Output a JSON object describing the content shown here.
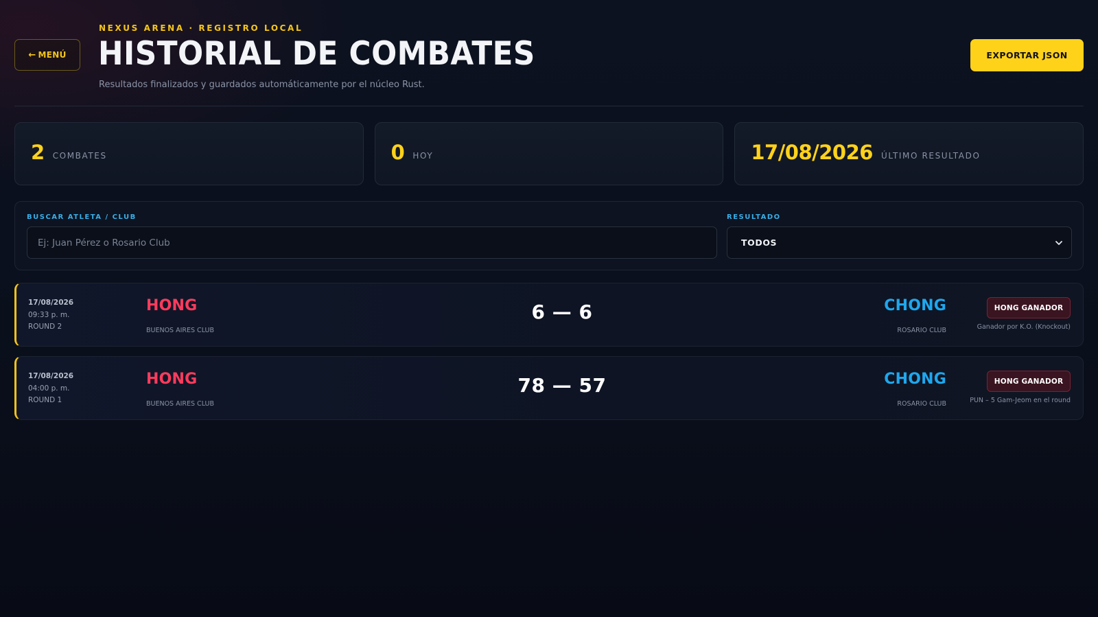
{
  "header": {
    "back_label": "MENÚ",
    "kicker": "NEXUS ARENA · REGISTRO LOCAL",
    "title": "HISTORIAL DE COMBATES",
    "subtitle": "Resultados finalizados y guardados automáticamente por el núcleo Rust.",
    "export_label": "EXPORTAR JSON"
  },
  "stats": [
    {
      "value": "2",
      "label": "COMBATES"
    },
    {
      "value": "0",
      "label": "HOY"
    },
    {
      "value": "17/08/2026",
      "label": "ÚLTIMO RESULTADO"
    }
  ],
  "filters": {
    "search_label": "BUSCAR ATLETA / CLUB",
    "search_placeholder": "Ej: Juan Pérez o Rosario Club",
    "search_value": "",
    "result_label": "RESULTADO",
    "result_value": "TODOS"
  },
  "fights": [
    {
      "date": "17/08/2026",
      "time": "09:33 p. m.",
      "round": "ROUND 2",
      "left_name": "HONG",
      "left_club": "BUENOS AIRES CLUB",
      "score": "6 — 6",
      "right_name": "CHONG",
      "right_club": "ROSARIO CLUB",
      "badge": "HONG GANADOR",
      "note": "Ganador por K.O. (Knockout)"
    },
    {
      "date": "17/08/2026",
      "time": "04:00 p. m.",
      "round": "ROUND 1",
      "left_name": "HONG",
      "left_club": "BUENOS AIRES CLUB",
      "score": "78 — 57",
      "right_name": "CHONG",
      "right_club": "ROSARIO CLUB",
      "badge": "HONG GANADOR",
      "note": "PUN – 5 Gam-Jeom en el round"
    }
  ],
  "colors": {
    "accent": "#ffd21a",
    "red_corner": "#ff3b5c",
    "blue_corner": "#1ea7ee",
    "label_blue": "#38aee8",
    "background": "#0a0f1c"
  },
  "icons": {
    "back": "arrow-left-icon",
    "select": "chevron-down-icon"
  }
}
